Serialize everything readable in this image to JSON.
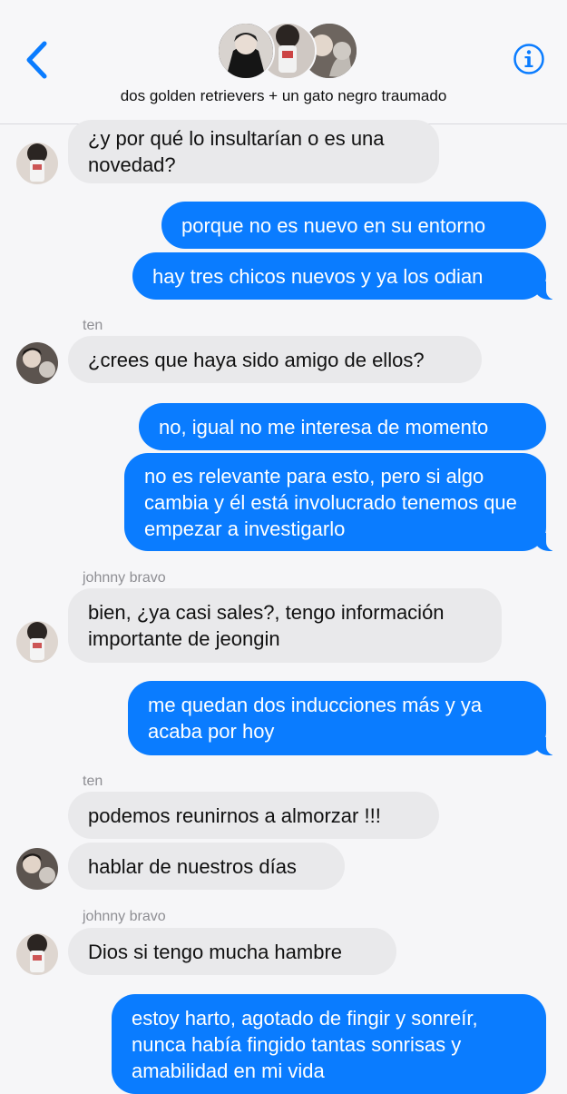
{
  "header": {
    "group_name": "dos golden retrievers + un gato negro traumado"
  },
  "messages": [
    {
      "text": "¿y por qué lo insultarían o es una novedad?"
    },
    {
      "text": "porque no es nuevo en su entorno"
    },
    {
      "text": "hay tres chicos nuevos y ya los odian"
    },
    {
      "sender": "ten"
    },
    {
      "text": "¿crees que haya sido amigo de ellos?"
    },
    {
      "text": "no, igual no me interesa de momento"
    },
    {
      "text": "no es relevante para esto, pero si algo cambia y él está involucrado tenemos que empezar a investigarlo"
    },
    {
      "sender": "johnny bravo"
    },
    {
      "text": "bien, ¿ya casi sales?, tengo información importante de jeongin"
    },
    {
      "text": "me quedan dos inducciones más y ya acaba por hoy"
    },
    {
      "sender": "ten"
    },
    {
      "text": "podemos reunirnos a almorzar !!!"
    },
    {
      "text": "hablar de nuestros días"
    },
    {
      "sender": "johnny bravo"
    },
    {
      "text": "Dios si tengo mucha hambre"
    },
    {
      "text": "estoy harto, agotado de fingir y sonreír, nunca había fingido tantas sonrisas y amabilidad en mi vida"
    }
  ],
  "colors": {
    "outgoing_bubble": "#0a7cff",
    "incoming_bubble": "#e9e9eb",
    "accent": "#0a7cff"
  },
  "icons": {
    "back": "chevron-left-icon",
    "info": "info-circle-icon"
  }
}
